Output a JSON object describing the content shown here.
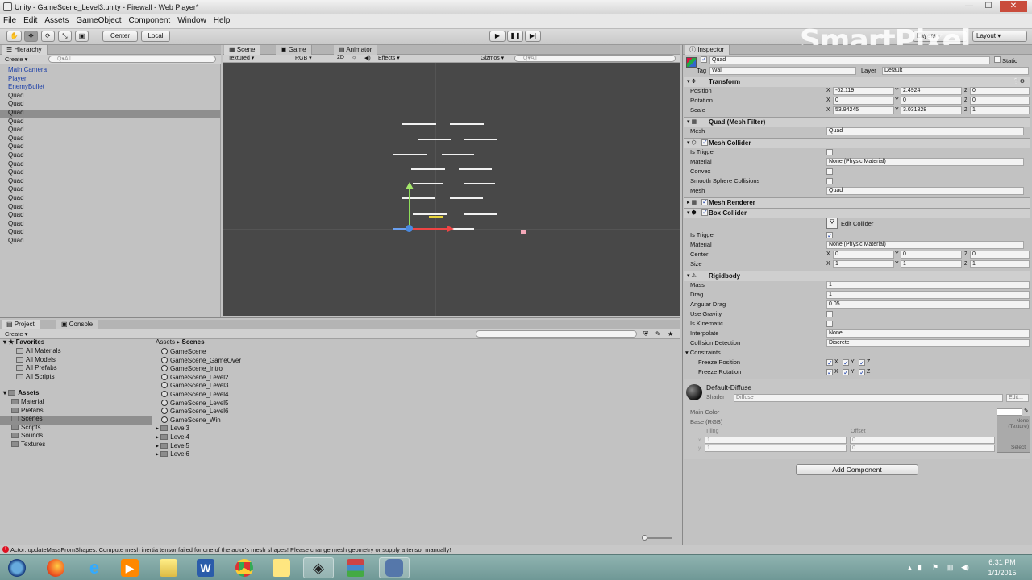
{
  "window": {
    "title": "Unity - GameScene_Level3.unity - Firewall - Web Player*",
    "minimize": "—",
    "maximize": "☐",
    "close": "✕"
  },
  "menu": [
    "File",
    "Edit",
    "Assets",
    "GameObject",
    "Component",
    "Window",
    "Help"
  ],
  "toolbar": {
    "center": "Center",
    "local": "Local",
    "layers": "Layers",
    "layout": "Layout"
  },
  "watermark": "SmartPixel",
  "hierarchy": {
    "tab": "Hierarchy",
    "create": "Create",
    "search": "Q▾All",
    "items": [
      "Main Camera",
      "Player",
      "EnemyBullet",
      "Quad",
      "Quad",
      "Quad",
      "Quad",
      "Quad",
      "Quad",
      "Quad",
      "Quad",
      "Quad",
      "Quad",
      "Quad",
      "Quad",
      "Quad",
      "Quad",
      "Quad",
      "Quad",
      "Quad",
      "Quad"
    ]
  },
  "scene": {
    "tabs": [
      "Scene",
      "Game",
      "Animator"
    ],
    "shading": "Textured",
    "rgb": "RGB",
    "mode2d": "2D",
    "effects": "Effects",
    "gizmos": "Gizmos",
    "search": "Q▾All"
  },
  "project": {
    "tabs": [
      "Project",
      "Console"
    ],
    "create": "Create",
    "breadcrumb_root": "Assets",
    "breadcrumb_sep": "▸",
    "breadcrumb_current": "Scenes",
    "favorites_label": "Favorites",
    "favorites": [
      "All Materials",
      "All Models",
      "All Prefabs",
      "All Scripts"
    ],
    "assets_label": "Assets",
    "folders": [
      "Material",
      "Prefabs",
      "Scenes",
      "Scripts",
      "Sounds",
      "Textures"
    ],
    "files": [
      "GameScene",
      "GameScene_GameOver",
      "GameScene_Intro",
      "GameScene_Level2",
      "GameScene_Level3",
      "GameScene_Level4",
      "GameScene_Level5",
      "GameScene_Level6",
      "GameScene_Win"
    ],
    "subfolders": [
      "Level3",
      "Level4",
      "Level5",
      "Level6"
    ]
  },
  "inspector": {
    "tab": "Inspector",
    "name": "Quad",
    "static": "Static",
    "tag_label": "Tag",
    "tag": "Wall",
    "layer_label": "Layer",
    "layer": "Default",
    "transform": {
      "title": "Transform",
      "position_label": "Position",
      "rotation_label": "Rotation",
      "scale_label": "Scale",
      "px": "-62.119",
      "py": "2.4924",
      "pz": "0",
      "rx": "0",
      "ry": "0",
      "rz": "0",
      "sx": "53.94245",
      "sy": "3.031828",
      "sz": "1"
    },
    "meshfilter": {
      "title": "Quad (Mesh Filter)",
      "mesh_label": "Mesh",
      "mesh": "Quad"
    },
    "meshcollider": {
      "title": "Mesh Collider",
      "is_trigger": "Is Trigger",
      "material_label": "Material",
      "material": "None (Physic Material)",
      "convex": "Convex",
      "smooth": "Smooth Sphere Collisions",
      "mesh_label": "Mesh",
      "mesh": "Quad"
    },
    "meshrenderer": {
      "title": "Mesh Renderer"
    },
    "boxcollider": {
      "title": "Box Collider",
      "edit": "Edit Collider",
      "is_trigger": "Is Trigger",
      "material_label": "Material",
      "material": "None (Physic Material)",
      "center_label": "Center",
      "cx": "0",
      "cy": "0",
      "cz": "0",
      "size_label": "Size",
      "sx": "1",
      "sy": "1",
      "sz": "1"
    },
    "rigidbody": {
      "title": "Rigidbody",
      "mass_label": "Mass",
      "mass": "1",
      "drag_label": "Drag",
      "drag": "1",
      "angdrag_label": "Angular Drag",
      "angdrag": "0.05",
      "gravity": "Use Gravity",
      "kinematic": "Is Kinematic",
      "interp_label": "Interpolate",
      "interp": "None",
      "collision_label": "Collision Detection",
      "collision": "Discrete",
      "constraints": "Constraints",
      "freeze_pos": "Freeze Position",
      "freeze_rot": "Freeze Rotation"
    },
    "material": {
      "name": "Default-Diffuse",
      "shader_label": "Shader",
      "shader": "Diffuse",
      "edit": "Edit...",
      "main_color": "Main Color",
      "base": "Base (RGB)",
      "tiling": "Tiling",
      "offset": "Offset",
      "tex_none": "None (Texture)",
      "select": "Select",
      "x": "x",
      "y": "y",
      "t1": "1",
      "t2": "1",
      "o1": "0",
      "o2": "0"
    },
    "add_component": "Add Component"
  },
  "status": "Actor::updateMassFromShapes: Compute mesh inertia tensor failed for one of the actor's mesh shapes! Please change mesh geometry or supply a tensor manually!",
  "taskbar": {
    "time": "6:31 PM",
    "date": "1/1/2015"
  },
  "colors": {
    "selection": "#8e8e8e",
    "scene_bg": "#484848",
    "link_blue": "#1a3ea8",
    "taskbar": "#7fa6a3"
  }
}
